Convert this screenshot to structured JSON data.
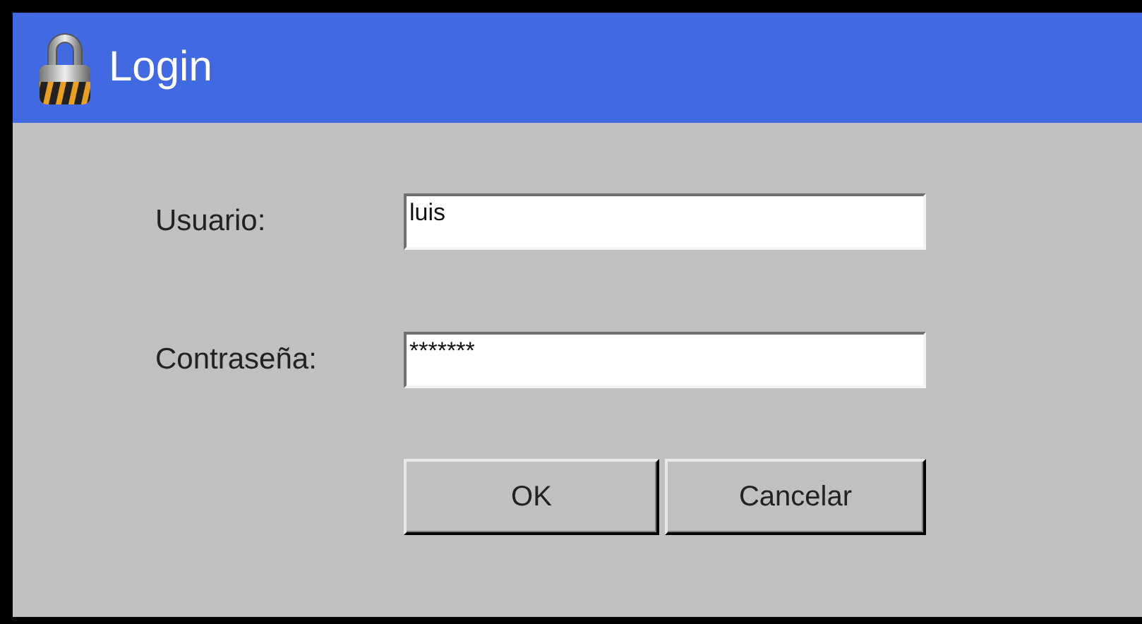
{
  "window": {
    "title": "Login"
  },
  "fields": [
    {
      "label": "Usuario:",
      "value": "luis"
    },
    {
      "label": "Contraseña:",
      "value": "*******"
    }
  ],
  "buttons": [
    "OK",
    "Cancelar"
  ]
}
